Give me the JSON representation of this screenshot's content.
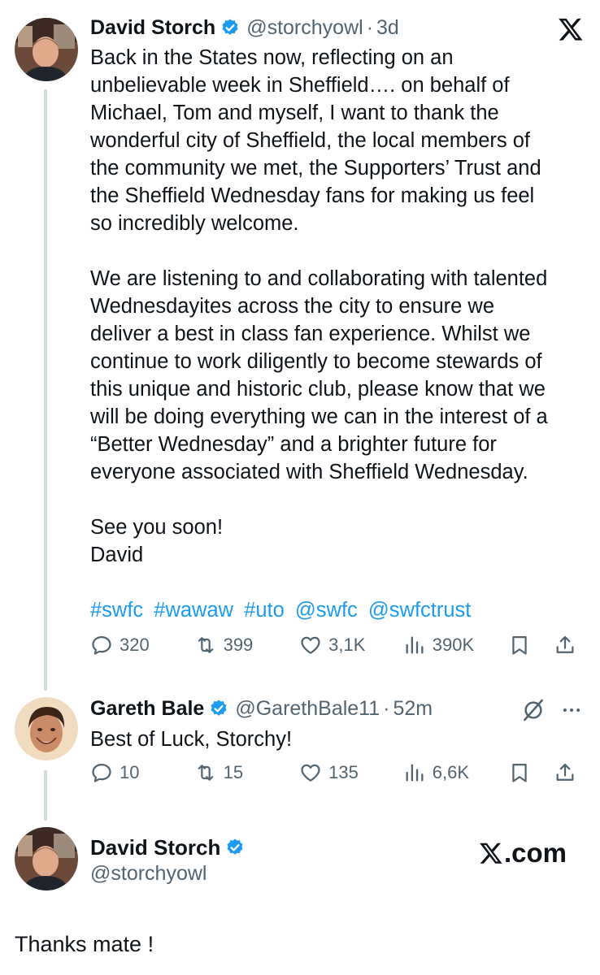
{
  "tweet": {
    "author_name": "David Storch",
    "author_handle": "@storchyowl",
    "separator": "·",
    "time": "3d",
    "paragraphs": [
      "Back in the States now, reflecting on an\nunbelievable week in Sheffield…. on behalf of\nMichael, Tom and myself, I want to thank the\nwonderful city of Sheffield, the local members of\nthe community we met, the Supporters’ Trust and\nthe Sheffield Wednesday fans for making us feel\nso incredibly welcome.",
      "We are listening to and collaborating with talented\nWednesdayites across the city to ensure we\ndeliver a best in class fan experience.  Whilst we\ncontinue to work diligently to become stewards of\nthis unique and historic club, please know that we\nwill be doing everything we can in the interest of a\n“Better Wednesday” and a brighter future for\neveryone associated with Sheffield Wednesday.",
      "See you soon!\nDavid"
    ],
    "tags": [
      "#swfc",
      "#wawaw",
      "#uto",
      "@swfc",
      "@swfctrust"
    ],
    "metrics": {
      "replies": "320",
      "reposts": "399",
      "likes": "3,1K",
      "views": "390K"
    }
  },
  "reply": {
    "author_name": "Gareth Bale",
    "author_handle": "@GarethBale11",
    "separator": "·",
    "time": "52m",
    "text": "Best of Luck, Storchy!",
    "metrics": {
      "replies": "10",
      "reposts": "15",
      "likes": "135",
      "views": "6,6K"
    }
  },
  "response": {
    "author_name": "David Storch",
    "author_handle": "@storchyowl",
    "watermark": ".com",
    "text": "Thanks mate !"
  },
  "icons": [
    "x-logo-icon",
    "verified-badge-icon",
    "reply-icon",
    "repost-icon",
    "like-icon",
    "views-icon",
    "bookmark-icon",
    "share-icon",
    "grok-icon",
    "more-icon"
  ],
  "colors": {
    "text": "#0f1419",
    "secondary": "#536471",
    "link": "#1d9bf0",
    "verified": "#1d9bf0",
    "thread_line": "#cfd9de"
  }
}
